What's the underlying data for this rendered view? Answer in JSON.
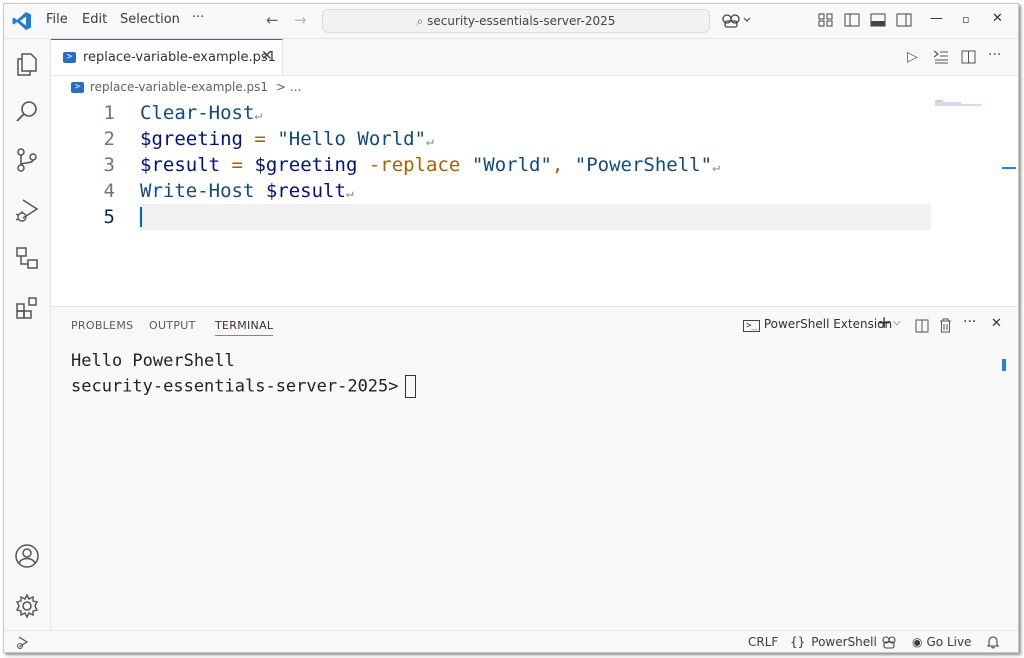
{
  "titlebar": {
    "menu": [
      "File",
      "Edit",
      "Selection",
      "···"
    ],
    "search_text": "security-essentials-server-2025"
  },
  "editor": {
    "tab_label": "replace-variable-example.ps1",
    "breadcrumb_file": "replace-variable-example.ps1",
    "breadcrumb_sep": ">",
    "breadcrumb_more": "...",
    "line_numbers": [
      "1",
      "2",
      "3",
      "4",
      "5"
    ],
    "lines": {
      "l1": {
        "kw": "Clear-Host"
      },
      "l2": {
        "var": "$greeting",
        "op": "=",
        "str": "\"Hello World\""
      },
      "l3": {
        "var": "$result",
        "op": "=",
        "var2": "$greeting",
        "flag": "-replace",
        "str1": "\"World\"",
        "comma": ",",
        "str2": "\"PowerShell\""
      },
      "l4": {
        "kw": "Write-Host",
        "var": "$result"
      }
    },
    "eol_glyph": "↵"
  },
  "panel": {
    "tabs": [
      "PROBLEMS",
      "OUTPUT",
      "TERMINAL"
    ],
    "active_tab": "TERMINAL",
    "terminal_name": "PowerShell Extension",
    "output_line": "Hello PowerShell",
    "prompt": "security-essentials-server-2025>"
  },
  "statusbar": {
    "eol": "CRLF",
    "language": "PowerShell",
    "golive": "Go Live"
  },
  "colors": {
    "accent": "#0078d4",
    "keyword": "#0f4a85",
    "variable": "#001080",
    "operator": "#af5f00",
    "terminal_tab_underline": "#e56c0c"
  },
  "icons": [
    "vscode-logo-icon",
    "explorer-icon",
    "search-icon",
    "source-control-icon",
    "run-debug-icon",
    "remote-explorer-icon",
    "extensions-icon",
    "account-icon",
    "settings-gear-icon",
    "copilot-icon",
    "layout-icon",
    "bell-icon"
  ]
}
